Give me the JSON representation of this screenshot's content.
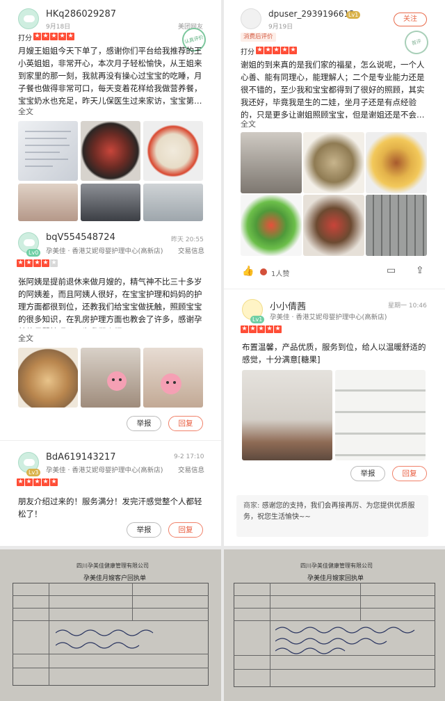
{
  "colors": {
    "star_on": "#ff4d36",
    "accent": "#e85a3c",
    "green_badge": "#6fcfa4"
  },
  "left": {
    "r1": {
      "user": "HKq286029287",
      "date": "9月18日",
      "source": "美团网友",
      "score_label": "打分",
      "stars": 5,
      "body": "月嫂王姐姐今天下单了，感谢你们平台给我推荐的王小英姐姐，非常开心，本次月子轻松愉快，从王姐来到家里的那一刻，我就再没有操心过宝宝的吃睡，月子餐也做得非常可口，每天变着花样给我做营养餐，宝宝奶水也充足，昨天儿保医生过来家访，宝宝第…",
      "more": "全文",
      "stamp": "认真评价"
    },
    "r2": {
      "user": "bqV554548724",
      "level": "Lv0",
      "time": "昨天 20:55",
      "shop": "孕美佳 · 香港艾妮母婴护理中心(高新店)",
      "deal": "交易信息",
      "stars": 4,
      "body": "张阿姨是提前退休来做月嫂的，精气神不比三十多岁的阿姨差，而且阿姨人很好，在宝宝护理和妈妈的护理方面都很到位，还教我们给宝宝做抚触，照顾宝宝的很多知识，在乳房护理方面也教会了许多，感谢孕美佳母婴护理公司为我们介绍",
      "more": "全文",
      "report": "举报",
      "reply": "回复"
    },
    "r3": {
      "user": "BdA619143217",
      "level": "Lv3",
      "time": "9-2 17:10",
      "shop": "孕美佳 · 香港艾妮母婴护理中心(高新店)",
      "deal": "交易信息",
      "stars": 5,
      "body": "朋友介绍过来的！服务满分！发完汗感觉整个人都轻松了！",
      "report": "举报",
      "reply": "回复"
    }
  },
  "right": {
    "r1": {
      "user": "dpuser_2939196613",
      "level": "Lv1",
      "follow": "关注",
      "date": "9月19日",
      "tag": "消费后评价",
      "score_label": "打分",
      "stars": 5,
      "body": "谢姐的到来真的是我们家的福星，怎么说呢，一个人心善、能有同理心，能理解人；二个是专业能力还是很不错的，至少我和宝宝都得到了很好的照顾，其实我还好，毕竟我是生的二娃，坐月子还是有点经验的，只是更多让谢姐照顾宝宝，但是谢姐还是不会…",
      "more": "全文",
      "stamp": "首评",
      "likes": "1人赞"
    },
    "r2": {
      "user": "小小倩茜",
      "level": "Lv1",
      "time": "星期一 10:46",
      "shop": "孕美佳 · 香港艾妮母婴护理中心(高新店)",
      "stars": 5,
      "body": "布置温馨，产品优质，服务到位，给人以温暖舒适的感觉，十分满意[糖果]",
      "report": "举报",
      "reply": "回复",
      "merchant_label": "商家:",
      "merchant_reply": "感谢您的支持，我们会再接再厉、为您提供优质服务，祝您生活愉快~~"
    }
  },
  "forms": {
    "left": {
      "company": "四川孕美佳健康管理有限公司",
      "title": "孕美佳月嫂客户回执单"
    },
    "right": {
      "company": "四川孕美佳健康管理有限公司",
      "title": "孕美佳月嫂家回执单"
    }
  }
}
